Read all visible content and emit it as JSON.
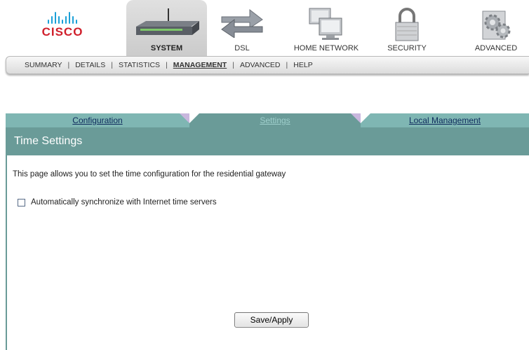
{
  "logo": {
    "text": "CISCO"
  },
  "nav": {
    "items": [
      {
        "label": "SYSTEM",
        "icon": "router-icon",
        "active": true
      },
      {
        "label": "DSL",
        "icon": "arrows-icon"
      },
      {
        "label": "HOME NETWORK",
        "icon": "computers-icon"
      },
      {
        "label": "SECURITY",
        "icon": "padlock-icon"
      },
      {
        "label": "ADVANCED",
        "icon": "gears-icon"
      }
    ]
  },
  "submenu": {
    "items": [
      "SUMMARY",
      "DETAILS",
      "STATISTICS",
      "MANAGEMENT",
      "ADVANCED",
      "HELP"
    ],
    "active": "MANAGEMENT"
  },
  "page_tabs": [
    {
      "label": "Configuration"
    },
    {
      "label": "Settings",
      "active": true
    },
    {
      "label": "Local Management"
    }
  ],
  "content": {
    "title": "Time Settings",
    "description": "This page allows you to set the time configuration for the residential gateway",
    "sync_checkbox": {
      "label": "Automatically synchronize with Internet time servers",
      "checked": false
    },
    "save_button": "Save/Apply"
  },
  "colors": {
    "panel": "#6a9b98",
    "inactive_tab": "#7fb6b3",
    "cisco_red": "#d0202c",
    "cisco_blue": "#1ba0d7"
  }
}
